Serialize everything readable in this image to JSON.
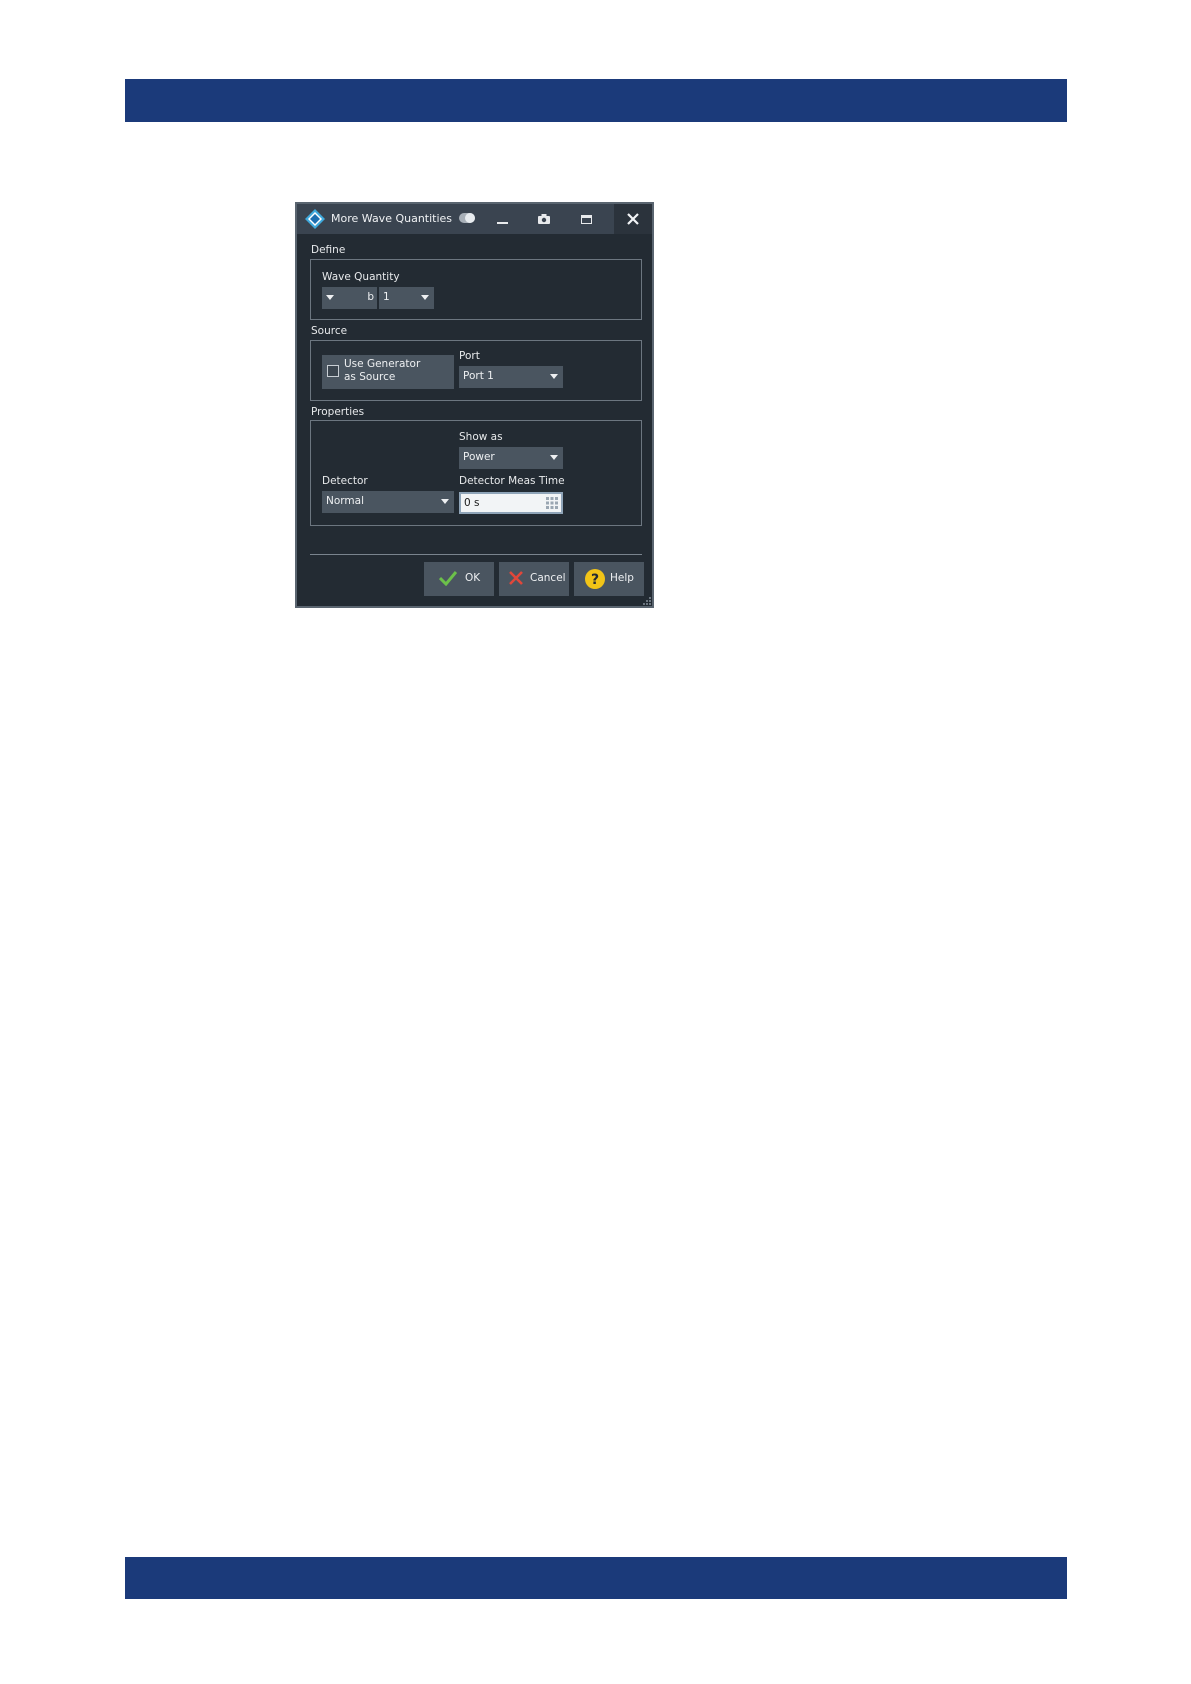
{
  "dialog": {
    "title": "More Wave Quantities",
    "icons": {
      "logo": "rohde-schwarz-logo-icon",
      "toggle": "toggle-icon",
      "minimize": "minimize-icon",
      "screenshot": "camera-icon",
      "maximize": "maximize-icon",
      "close": "close-icon"
    }
  },
  "define": {
    "section_label": "Define",
    "wave_quantity_label": "Wave Quantity",
    "wave_type_value": "b",
    "wave_port_value": "1"
  },
  "source": {
    "section_label": "Source",
    "use_generator_label_line1": "Use Generator",
    "use_generator_label_line2": "as Source",
    "use_generator_checked": false,
    "port_label": "Port",
    "port_value": "Port 1"
  },
  "properties": {
    "section_label": "Properties",
    "show_as_label": "Show as",
    "show_as_value": "Power",
    "detector_label": "Detector",
    "detector_value": "Normal",
    "meas_time_label": "Detector Meas Time",
    "meas_time_value": "0 s"
  },
  "buttons": {
    "ok_label": "OK",
    "cancel_label": "Cancel",
    "help_label": "Help"
  },
  "colors": {
    "header_band": "#1b3a7a",
    "dialog_background": "#232b33",
    "titlebar": "#3a4450",
    "control": "#4a5560",
    "ok_check": "#6cc04a",
    "cancel_x": "#e0473a",
    "help_circle": "#f2c417"
  }
}
